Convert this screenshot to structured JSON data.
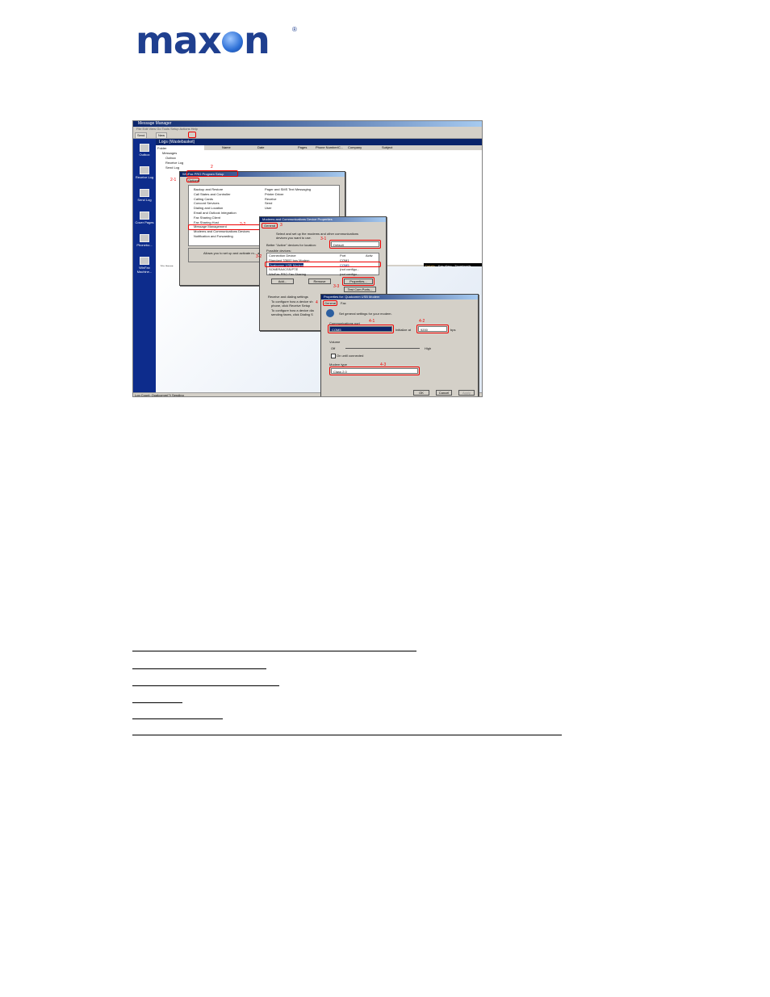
{
  "logo": {
    "text": "max",
    "text2": "n",
    "reg": "®"
  },
  "screenshot": {
    "title": "Message Manager",
    "menu": "File  Edit  View  Go  Tools  Setup  Actions  Help",
    "toolbar": [
      "Send",
      "New"
    ],
    "outlook_bar": [
      "Outbox",
      "Receive Log",
      "Send Log",
      "Cover Pages",
      "Phonebo...",
      "WinFax Machine..."
    ],
    "pane_title": "Logs (Wastebasket)",
    "folders": [
      "Folder",
      "Messages",
      "Outbox",
      "Receive Log",
      "Send Log"
    ],
    "list_columns": [
      "Name",
      "Date",
      "Pages",
      "Phone Number/C...",
      "Company",
      "Subject"
    ],
    "noitems": "No items",
    "views": [
      "Details",
      "Fax View",
      "Thumbnails"
    ],
    "status": "Log Count: Qualcomm(?)  Sending",
    "setup_dialog": {
      "title": "WinFax PRO Program Setup",
      "tab": "Options",
      "left_items": [
        "Backup and Restore",
        "Call States and Controller",
        "Calling Cards",
        "Concord Services",
        "Dialing and Location",
        "Email and Outlook Integration",
        "Fax Sharing Client",
        "Fax Sharing Host",
        "Message Management",
        "Modems and Communications Devices",
        "Notification and Forwarding"
      ],
      "right_items": [
        "Pager and SMS Text Messaging",
        "Printer Driver",
        "Receive",
        "Send",
        "User"
      ],
      "desc": "Allows you to set up and activate m... a specified location."
    },
    "modems_dialog": {
      "title": "Modems and Communications Device Properties",
      "tab": "General",
      "desc1": "Select and set up the modems and other communications",
      "desc2": "devices you want to use.",
      "location_label": "Better \"Active\" devices for location:",
      "location_value": "Default",
      "possible": "Possible devices:",
      "headers": [
        "Connection Device",
        "Port",
        "Activ"
      ],
      "rows": [
        [
          "Standard 33600 bps Modem",
          "COM1"
        ],
        [
          "Qualcomm USB Modem",
          "COM5"
        ],
        [
          "SONERA/ICSS/PTE",
          "(not configu..."
        ],
        [
          "WinFax PRO Fax Sharing",
          "(not configu..."
        ]
      ],
      "buttons": [
        "Add...",
        "Remove",
        "Properties..."
      ],
      "test": "Test Com Ports...",
      "recv_title": "Receive and dialing settings",
      "recv1": "To configure how a device sh",
      "recv2": "phone, click Receive Setup",
      "recv3": "To configure how a device dia",
      "recv4": "sending faxes, click Dialing S"
    },
    "props_dialog": {
      "title": "Properties for: Qualcomm USB Modem",
      "tabs": [
        "General",
        "Fax"
      ],
      "desc": "Set general settings for your modem.",
      "comm_port": "Communications port",
      "port_value": "COM5",
      "init_label": "Initialize at",
      "init_value": "9200",
      "bps": "bps",
      "volume": "Volume",
      "off": "Off",
      "high": "High",
      "on_until": "On until connected",
      "modem_type": "Modem type",
      "modem_value": "Class 2.0",
      "buttons": [
        "OK",
        "Cancel",
        "Apply"
      ]
    },
    "annotations": [
      "2",
      "2-1",
      "2-2",
      "3",
      "3-1",
      "3-2",
      "3-3",
      "4",
      "4-1",
      "4-2",
      "4-3"
    ]
  }
}
